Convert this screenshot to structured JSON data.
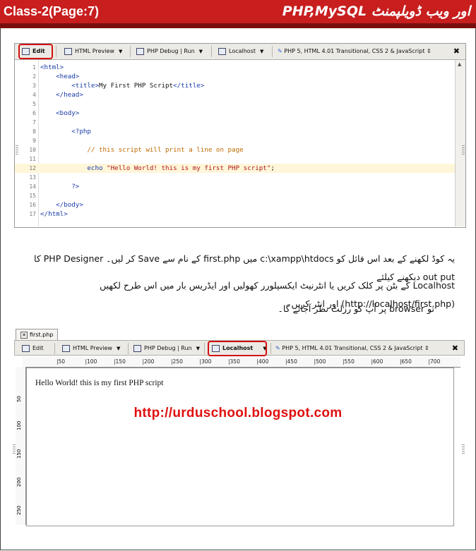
{
  "header": {
    "left_title": "Class-2(Page:7)",
    "right_title": "PHP,MySQL اور ویب ڈویلپمنٹ",
    "accent_color": "#c81e1e"
  },
  "editor1": {
    "toolbar": {
      "edit": "Edit",
      "html_preview": "HTML Preview",
      "php_debug": "PHP Debug | Run",
      "localhost": "Localhost",
      "doctype": "PHP 5, HTML 4.01 Transitional, CSS 2 & JavaScript",
      "close": "✖"
    },
    "lines": [
      {
        "n": "1",
        "t": "<html>",
        "c": "tag"
      },
      {
        "n": "2",
        "t": "    <head>",
        "c": "tag"
      },
      {
        "n": "3",
        "t": "        <title>",
        "c": "tag",
        "t2": "My First PHP Script",
        "t3": "</title>"
      },
      {
        "n": "4",
        "t": "    </head>",
        "c": "tag"
      },
      {
        "n": "5",
        "t": "",
        "c": "plain"
      },
      {
        "n": "6",
        "t": "    <body>",
        "c": "tag"
      },
      {
        "n": "7",
        "t": "",
        "c": "plain"
      },
      {
        "n": "8",
        "t": "        <?php",
        "c": "tag"
      },
      {
        "n": "9",
        "t": "",
        "c": "plain"
      },
      {
        "n": "10",
        "t": "            // this script will print a line on page",
        "c": "cmt"
      },
      {
        "n": "11",
        "t": "",
        "c": "plain"
      },
      {
        "n": "12",
        "t": "            echo ",
        "c": "kw",
        "t2": "\"Hello World! this is my first PHP script\"",
        "t3": ";",
        "hl": true
      },
      {
        "n": "13",
        "t": "",
        "c": "plain"
      },
      {
        "n": "14",
        "t": "        ?>",
        "c": "tag"
      },
      {
        "n": "15",
        "t": "",
        "c": "plain"
      },
      {
        "n": "16",
        "t": "    </body>",
        "c": "tag"
      },
      {
        "n": "17",
        "t": "</html>",
        "c": "tag"
      }
    ]
  },
  "paragraph": {
    "line1": "یہ کوڈ لکھنے کے بعد اس فائل کو c:\\xampp\\htdocs میں first.php کے نام سے Save کر لیں۔ PHP Designer کا out put دیکھنے کیلئے",
    "line2": "Localhost کے بٹن پر کلک کریں یا انٹرنیٹ ایکسپلورر کھولیں اور ایڈریس بار میں اس طرح لکھیں (http://localhost/first.php) اور انٹر کریں",
    "line3": "تو browser پر آپ کو رزلٹ نظر آجائے گا۔"
  },
  "editor2": {
    "file_tab": "first.php",
    "toolbar": {
      "edit": "Edit",
      "html_preview": "HTML Preview",
      "php_debug": "PHP Debug | Run",
      "localhost": "Localhost",
      "doctype": "PHP 5, HTML 4.01 Transitional, CSS 2 & JavaScript",
      "close": "✖"
    },
    "ruler": [
      "50",
      "100",
      "150",
      "200",
      "250",
      "300",
      "350",
      "400",
      "450",
      "500",
      "550",
      "600",
      "650",
      "700"
    ],
    "vruler": [
      "50",
      "100",
      "150",
      "200",
      "250"
    ],
    "output": "Hello World! this is my first PHP script"
  },
  "footer_url": "http://urduschool.blogspot.com"
}
